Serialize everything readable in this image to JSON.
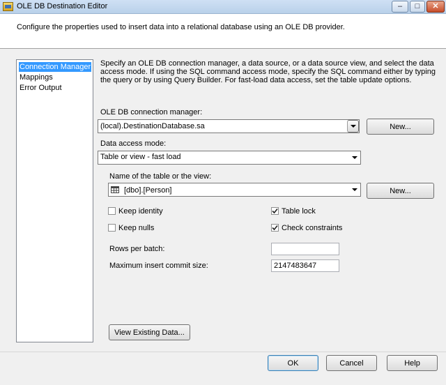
{
  "window": {
    "title": "OLE DB Destination Editor",
    "minimize_glyph": "–",
    "maximize_glyph": "□",
    "close_glyph": "✕"
  },
  "header": {
    "description": "Configure the properties used to insert data into a relational database using an OLE DB provider."
  },
  "nav": {
    "items": [
      {
        "label": "Connection Manager",
        "selected": true
      },
      {
        "label": "Mappings",
        "selected": false
      },
      {
        "label": "Error Output",
        "selected": false
      }
    ]
  },
  "main": {
    "description": "Specify an OLE DB connection manager, a data source, or a data source view, and select the data access mode. If using the SQL command access mode, specify the SQL command either by typing the query or by using Query Builder. For fast-load data access, set the table update options.",
    "connection_manager_label": "OLE DB connection manager:",
    "connection_manager_value": "(local).DestinationDatabase.sa",
    "new_connection_label": "New...",
    "data_access_mode_label": "Data access mode:",
    "data_access_mode_value": "Table or view - fast load",
    "table_name_label": "Name of the table or the view:",
    "table_name_value": "[dbo].[Person]",
    "new_table_label": "New...",
    "options": {
      "keep_identity": {
        "label": "Keep identity",
        "checked": false
      },
      "table_lock": {
        "label": "Table lock",
        "checked": true
      },
      "keep_nulls": {
        "label": "Keep nulls",
        "checked": false
      },
      "check_constraints": {
        "label": "Check constraints",
        "checked": true
      }
    },
    "rows_per_batch_label": "Rows per batch:",
    "rows_per_batch_value": "",
    "max_insert_commit_label": "Maximum insert commit size:",
    "max_insert_commit_value": "2147483647",
    "view_existing_data_label": "View Existing Data..."
  },
  "footer": {
    "ok_label": "OK",
    "cancel_label": "Cancel",
    "help_label": "Help"
  },
  "colors": {
    "selection": "#3399ff",
    "titlebar": "#b9d1ea",
    "close_button": "#c74d2b"
  }
}
